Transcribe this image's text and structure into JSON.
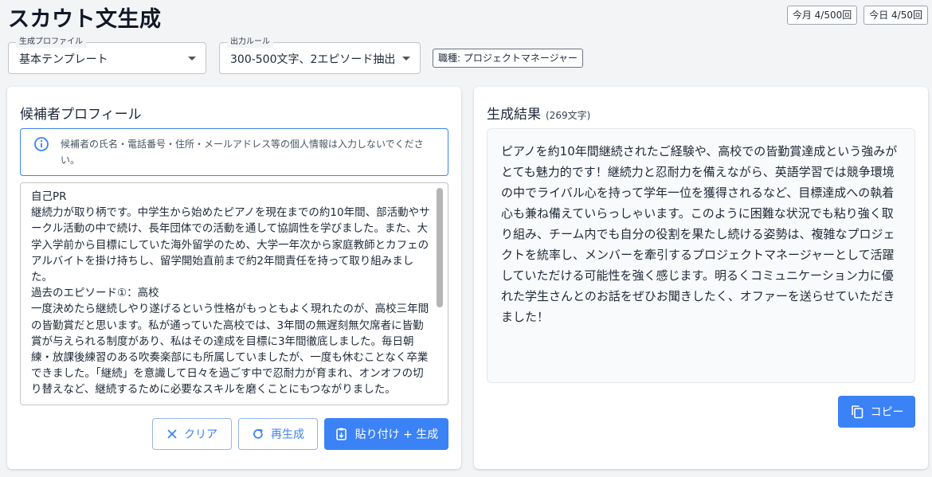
{
  "header": {
    "title": "スカウト文生成",
    "usage_month": "今月 4/500回",
    "usage_today": "今日 4/50回"
  },
  "controls": {
    "profile_select": {
      "legend": "生成プロファイル",
      "value": "基本テンプレート"
    },
    "rule_select": {
      "legend": "出力ルール",
      "value": "300-500文字、2エピソード抽出"
    },
    "role_badge": "職種: プロジェクトマネージャー"
  },
  "left_panel": {
    "title": "候補者プロフィール",
    "alert": "候補者の氏名・電話番号・住所・メールアドレス等の個人情報は入力しないでください。",
    "profile_text": "自己PR\n継続力が取り柄です。中学生から始めたピアノを現在までの約10年間、部活動やサークル活動の中で続け、長年団体での活動を通して協調性を学びました。また、大学入学前から目標にしていた海外留学のため、大学一年次から家庭教師とカフェのアルバイトを掛け持ちし、留学開始直前まで約2年間責任を持って取り組みました。\n過去のエピソード①：高校\n一度決めたら継続しやり遂げるという性格がもっともよく現れたのが、高校三年間の皆勤賞だと思います。私が通っていた高校では、3年間の無遅刻無欠席者に皆勤賞が与えられる制度があり、私はその達成を目標に3年間徹底しました。毎日朝練・放課後練習のある吹奏楽部にも所属していましたが、一度も休むことなく卒業できました。「継続」を意識して日々を過ごす中で忍耐力が育まれ、オンオフの切り替えなど、継続するために必要なスキルを磨くことにもつながりました。",
    "buttons": {
      "clear": "クリア",
      "regenerate": "再生成",
      "paste_generate": "貼り付け + 生成"
    }
  },
  "right_panel": {
    "title": "生成結果",
    "char_count": "(269文字)",
    "result_text": "ピアノを約10年間継続されたご経験や、高校での皆勤賞達成という強みがとても魅力的です！継続力と忍耐力を備えながら、英語学習では競争環境の中でライバル心を持って学年一位を獲得されるなど、目標達成への執着心も兼ね備えていらっしゃいます。このように困難な状況でも粘り強く取り組み、チーム内でも自分の役割を果たし続ける姿勢は、複雑なプロジェクトを統率し、メンバーを牽引するプロジェクトマネージャーとして活躍していただける可能性を強く感じます。明るくコミュニケーション力に優れた学生さんとのお話をぜひお聞きしたく、オファーを送らせていただきました！",
    "copy_button": "コピー"
  },
  "colors": {
    "accent": "#3b82f6",
    "background": "#f3f4f6"
  }
}
